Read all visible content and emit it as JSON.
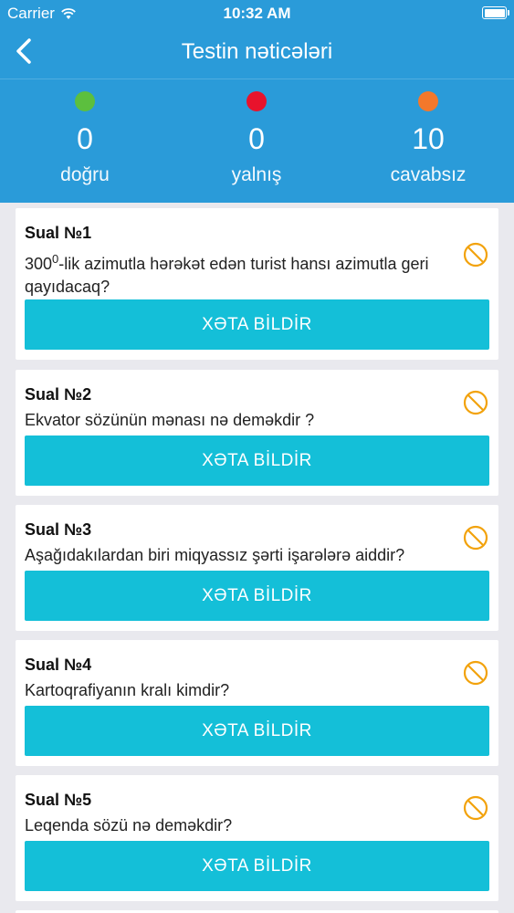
{
  "status_bar": {
    "carrier": "Carrier",
    "time": "10:32 AM"
  },
  "nav": {
    "title": "Testin nəticələri"
  },
  "stats": [
    {
      "value": "0",
      "label": "doğru",
      "color": "#5cbf3e"
    },
    {
      "value": "0",
      "label": "yalnış",
      "color": "#e8132c"
    },
    {
      "value": "10",
      "label": "cavabsız",
      "color": "#f3782b"
    }
  ],
  "questions": [
    {
      "title": "Sual №1",
      "text_main": "300",
      "text_sup": "0",
      "text_rest": "-lik azimutla hərəkət edən turist hansı azimutla geri qayıdacaq?",
      "button": "XƏTA BİLDİR"
    },
    {
      "title": "Sual №2",
      "text": "Ekvator sözünün mənası nə deməkdir ?",
      "button": "XƏTA BİLDİR"
    },
    {
      "title": "Sual №3",
      "text": "Aşağıdakılardan biri miqyassız şərti işarələrə aiddir?",
      "button": "XƏTA BİLDİR"
    },
    {
      "title": "Sual №4",
      "text": "Kartoqrafiyanın kralı kimdir?",
      "button": "XƏTA BİLDİR"
    },
    {
      "title": "Sual №5",
      "text": "Leqenda sözü nə deməkdir?",
      "button": "XƏTA BİLDİR"
    }
  ],
  "colors": {
    "header": "#2a9bd9",
    "button": "#14bfd8",
    "unanswered_icon": "#f2a20c"
  }
}
